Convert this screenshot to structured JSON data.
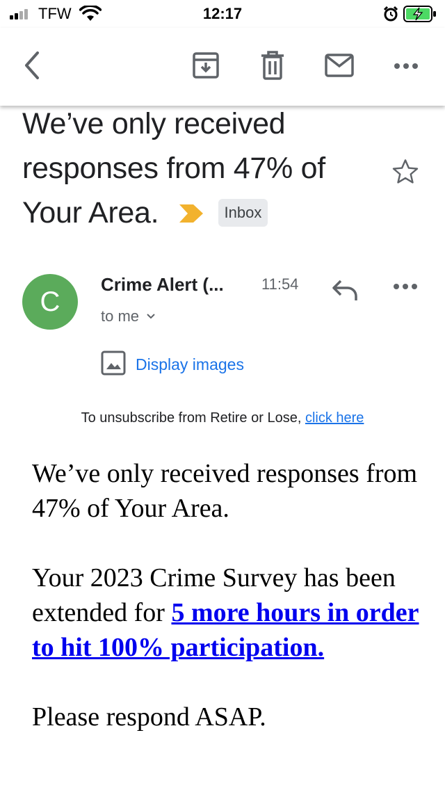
{
  "status_bar": {
    "carrier": "TFW",
    "time": "12:17",
    "icons": [
      "signal-icon",
      "wifi-icon",
      "alarm-icon",
      "battery-charging-icon"
    ]
  },
  "toolbar": {
    "icons": [
      "back-arrow-icon",
      "archive-icon",
      "trash-icon",
      "mail-icon",
      "more-icon"
    ]
  },
  "email": {
    "subject": "We’ve only received responses from 47% of Your Area.",
    "label": "Inbox",
    "importance_color": "#f2b22e",
    "sender_name": "Crime Alert (...",
    "sender_initial": "C",
    "avatar_color": "#5bab5b",
    "time": "11:54",
    "recipient": "to me",
    "display_images": "Display images"
  },
  "body": {
    "unsubscribe_text": "To unsubscribe from Retire or Lose, ",
    "unsubscribe_link": "click here",
    "paragraph1": "We’ve only received responses from 47% of Your Area.",
    "paragraph2_prefix": "Your 2023 Crime Survey has been extended for ",
    "paragraph2_link": "5 more hours in order to hit 100% participation.",
    "paragraph3": "Please respond ASAP."
  }
}
